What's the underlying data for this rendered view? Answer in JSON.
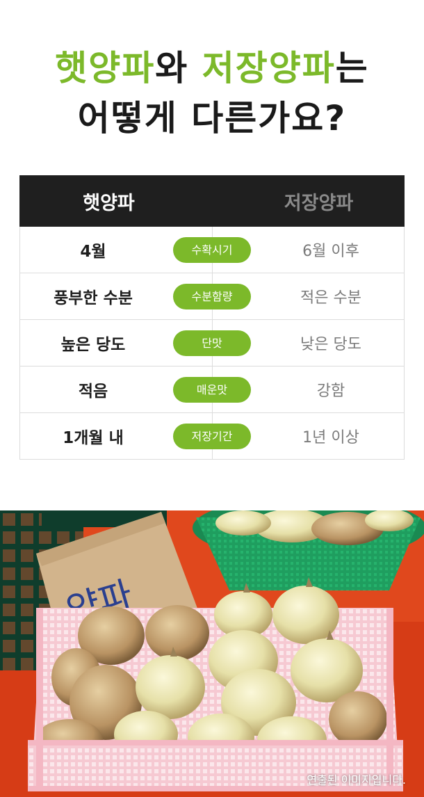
{
  "title": {
    "line1_part1": "햇양파",
    "line1_part2": "와 ",
    "line1_part3": "저장양파",
    "line1_part4": "는",
    "line2": "어떻게 다른가요?"
  },
  "table": {
    "header_new": "햇양파",
    "header_stored": "저장양파",
    "rows": [
      {
        "new": "4월",
        "label": "수확시기",
        "stored": "6월 이후"
      },
      {
        "new": "풍부한 수분",
        "label": "수분함량",
        "stored": "적은 수분"
      },
      {
        "new": "높은 당도",
        "label": "단맛",
        "stored": "낮은 당도"
      },
      {
        "new": "적음",
        "label": "매운맛",
        "stored": "강함"
      },
      {
        "new": "1개월 내",
        "label": "저장기간",
        "stored": "1년 이상"
      }
    ]
  },
  "photo": {
    "sign_text": "양파",
    "caption": "연출된 이미지입니다."
  },
  "colors": {
    "accent": "#7cb92a",
    "header_bg": "#1f1f1f",
    "table_border": "#dcdcdc"
  }
}
